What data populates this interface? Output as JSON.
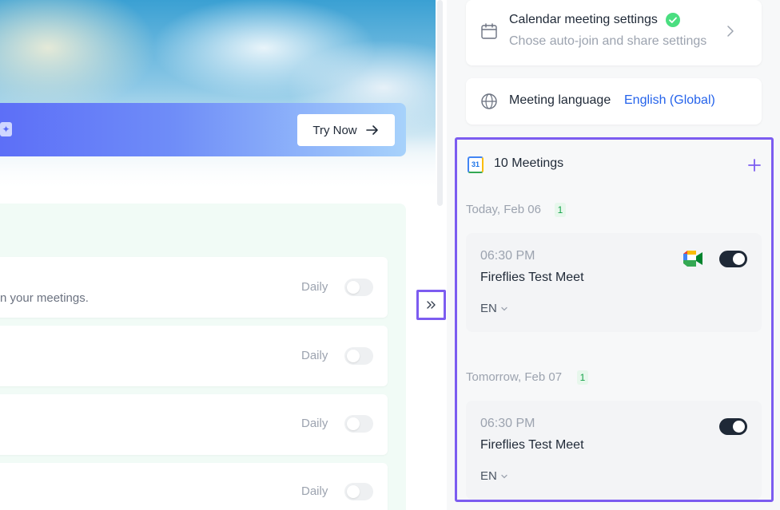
{
  "promo": {
    "try_now_label": "Try Now"
  },
  "feature_rows": [
    {
      "frequency": "Daily",
      "description": "n your meetings."
    },
    {
      "frequency": "Daily"
    },
    {
      "frequency": "Daily"
    },
    {
      "frequency": "Daily"
    }
  ],
  "settings": {
    "calendar_title": "Calendar meeting settings",
    "calendar_subtitle": "Chose auto-join and share settings",
    "language_label": "Meeting language",
    "language_value": "English (Global)"
  },
  "meetings": {
    "count_label": "10 Meetings",
    "calendar_icon_text": "31",
    "groups": [
      {
        "date_label": "Today, Feb 06",
        "count": "1",
        "items": [
          {
            "time": "06:30 PM",
            "title": "Fireflies Test Meet",
            "language": "EN",
            "enabled": true
          }
        ]
      },
      {
        "date_label": "Tomorrow, Feb 07",
        "count": "1",
        "items": [
          {
            "time": "06:30 PM",
            "title": "Fireflies Test Meet",
            "language": "EN",
            "enabled": true
          }
        ]
      }
    ]
  },
  "colors": {
    "accent": "#7c5cf0",
    "link": "#2563eb",
    "success": "#22c55e",
    "toggle_on": "#1f2937"
  }
}
